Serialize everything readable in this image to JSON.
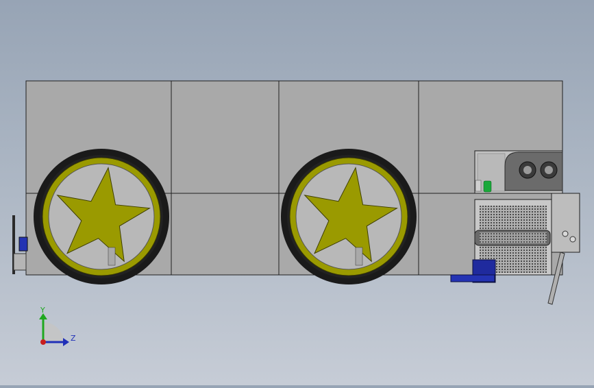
{
  "viewport": {
    "background_top": "#97a4b5",
    "background_bottom": "#c6ccd6"
  },
  "model": {
    "body_color": "#a9a9a9",
    "edge_color": "#1e1e1e",
    "wheel_tire_color": "#1a1a1a",
    "wheel_hub_color": "#9a9a00",
    "wheel_count": 2,
    "motor_mount_color": "#1f2a9e"
  },
  "triad": {
    "y_label": "Y",
    "z_label": "Z",
    "y_color": "#1fa81f",
    "z_color": "#2030b8",
    "x_color": "#c81e1e"
  }
}
